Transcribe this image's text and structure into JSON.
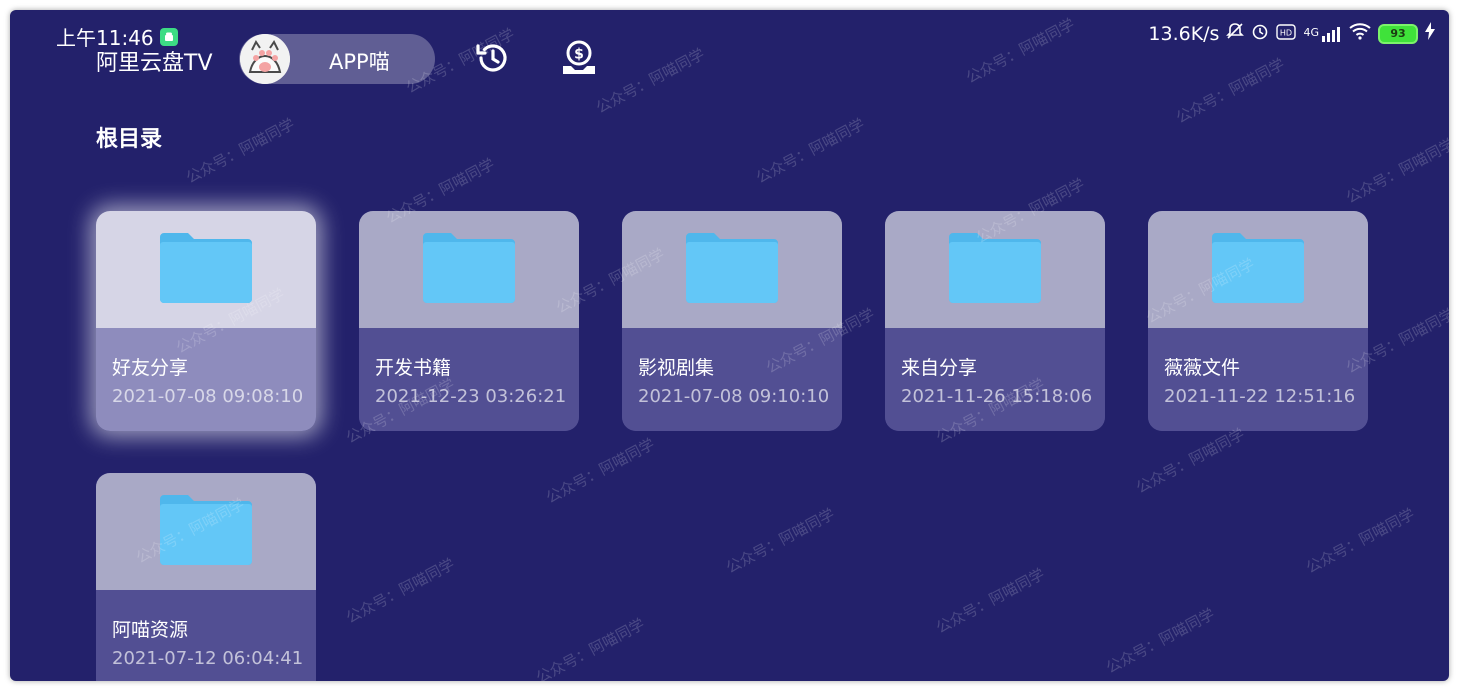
{
  "status_bar": {
    "time": "上午11:46",
    "net_speed": "13.6K/s",
    "network": "4G",
    "battery": "93"
  },
  "header": {
    "app_title": "阿里云盘TV",
    "user_name": "APP喵"
  },
  "section_title": "根目录",
  "folders": [
    {
      "name": "好友分享",
      "date": "2021-07-08 09:08:10"
    },
    {
      "name": "开发书籍",
      "date": "2021-12-23 03:26:21"
    },
    {
      "name": "影视剧集",
      "date": "2021-07-08 09:10:10"
    },
    {
      "name": "来自分享",
      "date": "2021-11-26 15:18:06"
    },
    {
      "name": "薇薇文件",
      "date": "2021-11-22 12:51:16"
    },
    {
      "name": "阿喵资源",
      "date": "2021-07-12 06:04:41"
    }
  ],
  "watermark_text": "公众号：阿喵同学",
  "colors": {
    "background": "#23216b",
    "folder": "#5ec4f5",
    "accent_battery": "#3fe23a"
  }
}
